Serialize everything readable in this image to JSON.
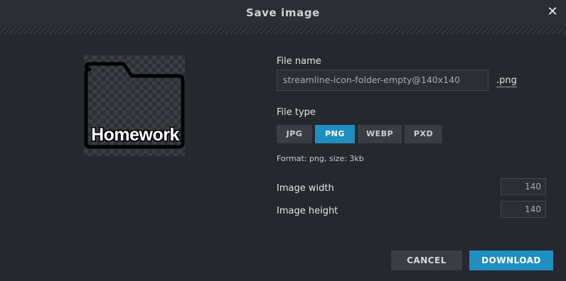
{
  "dialog": {
    "title": "Save image",
    "close_icon": "close-icon"
  },
  "preview": {
    "icon": "folder-icon",
    "label": "Homework"
  },
  "file_name": {
    "label": "File name",
    "value": "streamline-icon-folder-empty@140x140",
    "extension": ".png"
  },
  "file_type": {
    "label": "File type",
    "options": [
      "JPG",
      "PNG",
      "WEBP",
      "PXD"
    ],
    "selected": "PNG"
  },
  "format_info": "Format: png, size: 3kb",
  "image_width": {
    "label": "Image width",
    "value": "140"
  },
  "image_height": {
    "label": "Image height",
    "value": "140"
  },
  "buttons": {
    "cancel": "CANCEL",
    "download": "DOWNLOAD"
  },
  "colors": {
    "accent": "#1f8ec1",
    "background": "#25282d",
    "button": "#3a3d43"
  }
}
